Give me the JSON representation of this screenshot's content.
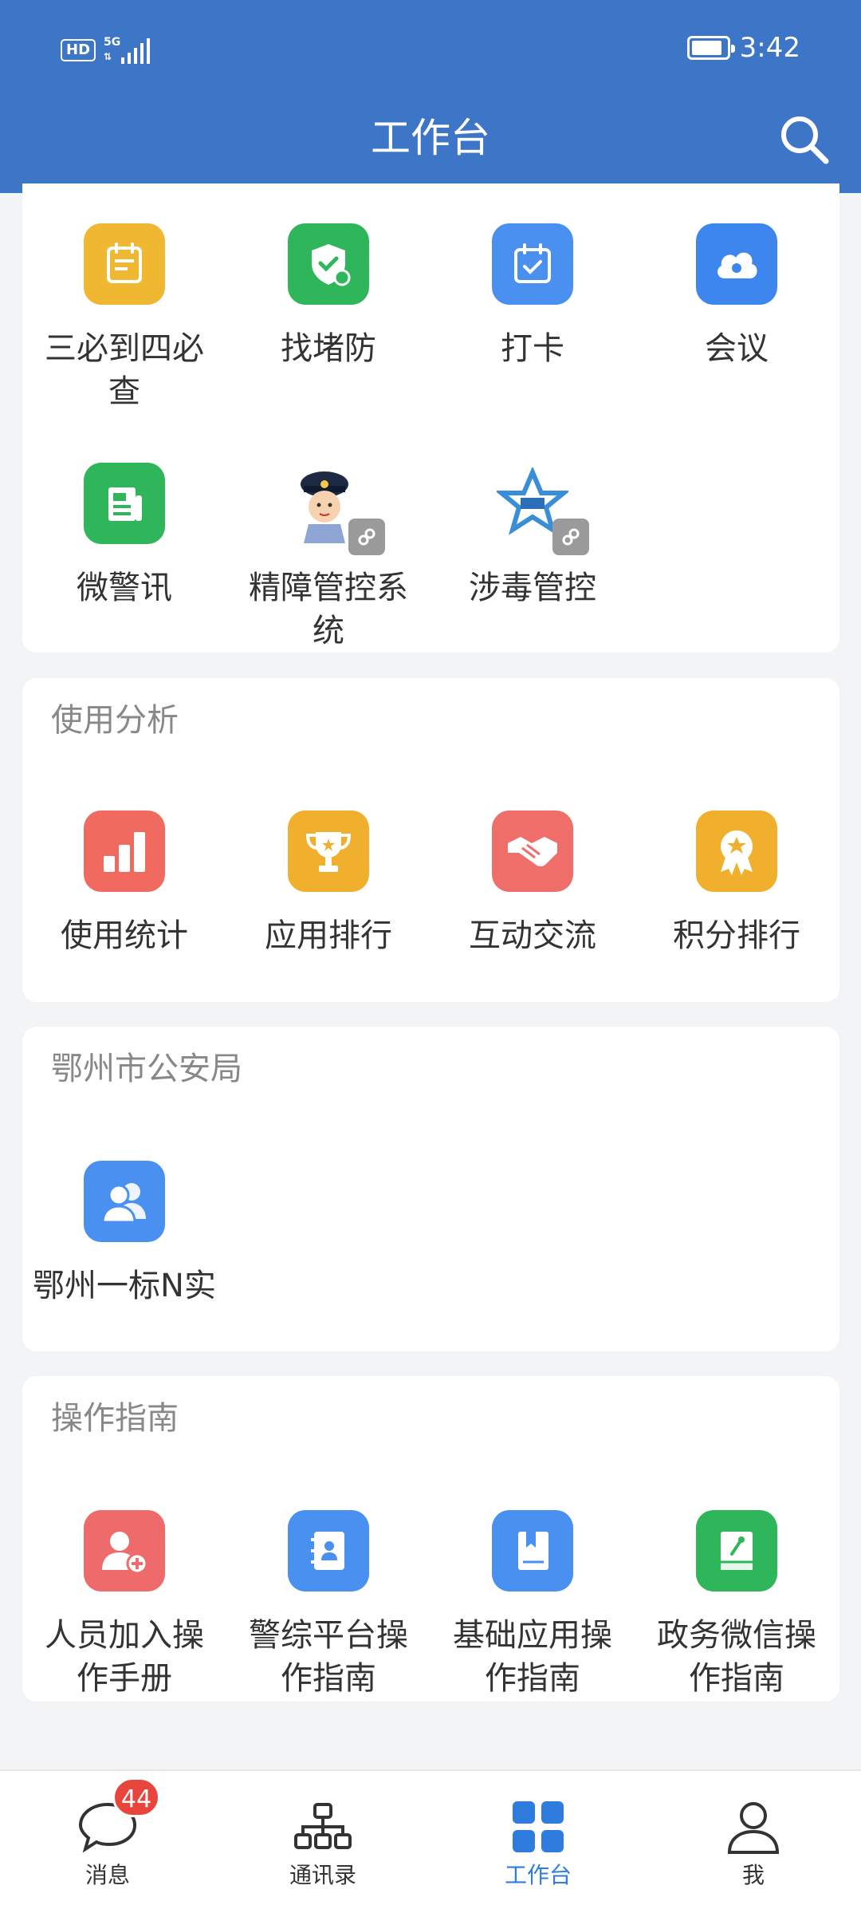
{
  "status_bar": {
    "hd": "HD",
    "network": "5G",
    "time": "3:42",
    "battery_level": 0.9
  },
  "header": {
    "title": "工作台"
  },
  "sections": {
    "top": {
      "apps": [
        {
          "label": "三必到四必查",
          "icon": "checklist-icon",
          "color": "#f0b731"
        },
        {
          "label": "找堵防",
          "icon": "shield-search-icon",
          "color": "#2fb65a"
        },
        {
          "label": "打卡",
          "icon": "calendar-check-icon",
          "color": "#4a90f0"
        },
        {
          "label": "会议",
          "icon": "cloud-phone-icon",
          "color": "#3d86ee"
        },
        {
          "label": "微警讯",
          "icon": "newspaper-icon",
          "color": "#2fb65a"
        },
        {
          "label": "精障管控系统",
          "icon": "police-avatar-icon",
          "color": "#ffffff"
        },
        {
          "label": "涉毒管控",
          "icon": "star-logo-icon",
          "color": "#ffffff"
        }
      ]
    },
    "usage": {
      "title": "使用分析",
      "apps": [
        {
          "label": "使用统计",
          "icon": "bar-chart-icon",
          "color": "#f06a60"
        },
        {
          "label": "应用排行",
          "icon": "trophy-icon",
          "color": "#f0b02e"
        },
        {
          "label": "互动交流",
          "icon": "handshake-icon",
          "color": "#ef6e6a"
        },
        {
          "label": "积分排行",
          "icon": "medal-icon",
          "color": "#f0b02e"
        }
      ]
    },
    "bureau": {
      "title": "鄂州市公安局",
      "apps": [
        {
          "label": "鄂州一标N实",
          "icon": "users-icon",
          "color": "#4a90f0"
        }
      ]
    },
    "guide": {
      "title": "操作指南",
      "apps": [
        {
          "label": "人员加入操作手册",
          "icon": "user-add-icon",
          "color": "#ef6a6a"
        },
        {
          "label": "警综平台操作指南",
          "icon": "contact-book-icon",
          "color": "#4a90f0"
        },
        {
          "label": "基础应用操作指南",
          "icon": "book-icon",
          "color": "#4a90f0"
        },
        {
          "label": "政务微信操作指南",
          "icon": "green-book-icon",
          "color": "#2fb65a"
        }
      ]
    }
  },
  "tabbar": {
    "items": [
      {
        "label": "消息",
        "badge": "44"
      },
      {
        "label": "通讯录"
      },
      {
        "label": "工作台"
      },
      {
        "label": "我"
      }
    ],
    "active_color": "#2f7cdf"
  },
  "colors": {
    "header": "#3d75c7",
    "background": "#f3f4f6"
  }
}
